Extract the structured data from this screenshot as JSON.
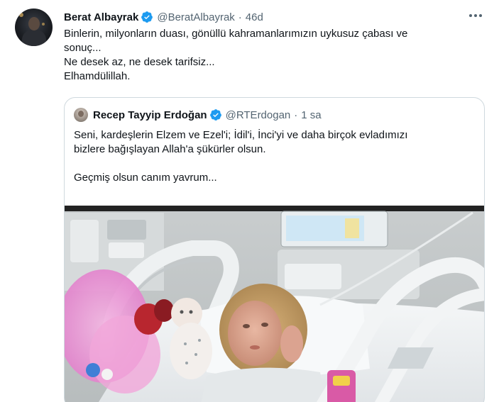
{
  "tweet": {
    "author_name": "Berat Albayrak",
    "author_handle": "@BeratAlbayrak",
    "separator": "·",
    "time": "46d",
    "text_lines": [
      "Binlerin, milyonların duası, gönüllü kahramanlarımızın uykusuz çabası ve",
      "sonuç...",
      "Ne desek az, ne desek tarifsiz...",
      "Elhamdülillah."
    ]
  },
  "quoted_tweet": {
    "author_name": "Recep Tayyip Erdoğan",
    "author_handle": "@RTErdogan",
    "separator": "·",
    "time": "1 sa",
    "text_lines": [
      "Seni, kardeşlerin Elzem ve Ezel'i; İdil'i, İnci'yi ve daha birçok evladımızı",
      "bizlere bağışlayan Allah'a şükürler olsun.",
      "",
      "Geçmiş olsun canım yavrum..."
    ]
  },
  "colors": {
    "verified_blue": "#1d9bf0",
    "secondary_text": "#536471",
    "border": "#cfd9de"
  },
  "icons": {
    "verified": "verified-badge-icon",
    "more": "more-options-icon"
  }
}
